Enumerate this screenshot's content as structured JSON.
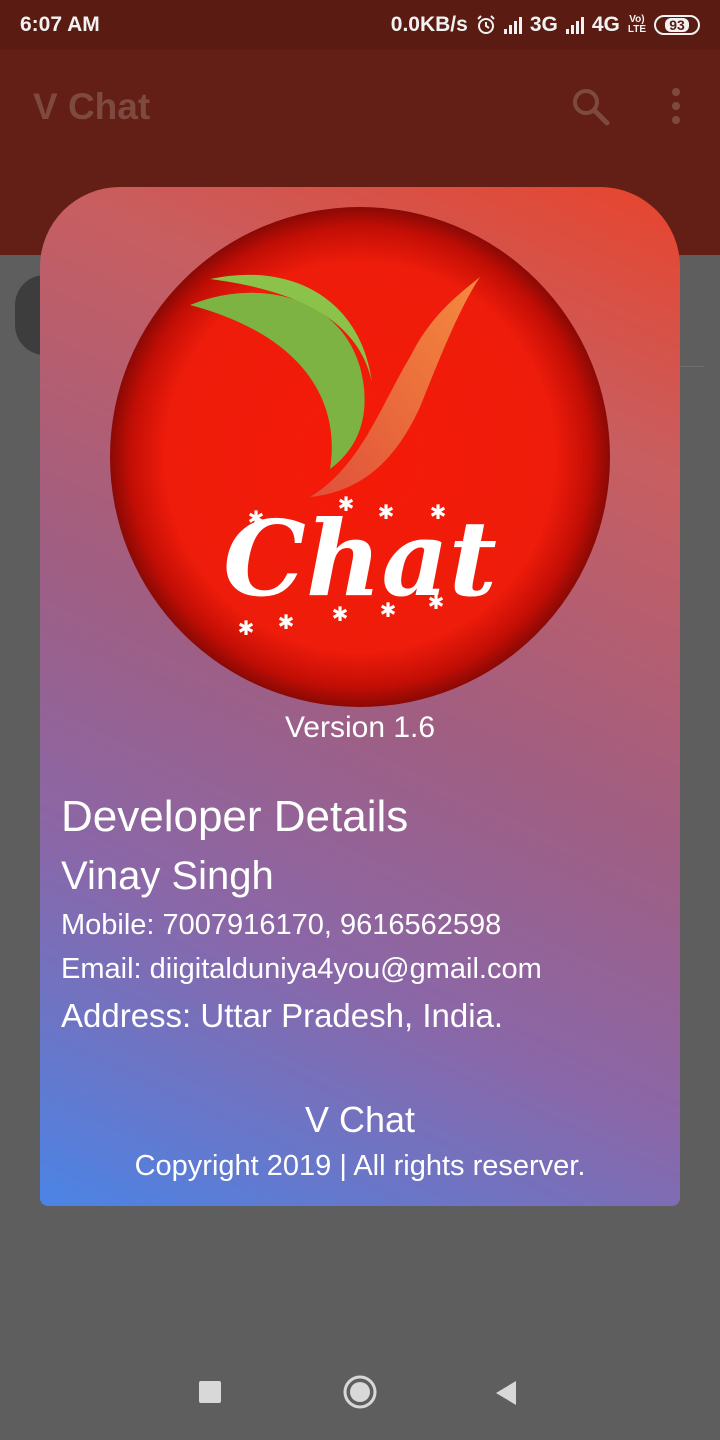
{
  "status_bar": {
    "time": "6:07 AM",
    "speed": "0.0KB/s",
    "net1": "3G",
    "net2": "4G",
    "volte_top": "Vo)",
    "volte_bottom": "LTE",
    "battery": "93"
  },
  "app_bar": {
    "title": "V Chat",
    "icons": [
      "search-icon",
      "more-vert-icon"
    ]
  },
  "dialog": {
    "logo_text": "Chat",
    "version": "Version 1.6",
    "developer_heading": "Developer Details",
    "developer_name": "Vinay Singh",
    "mobile": "Mobile: 7007916170, 9616562598",
    "email": "Email: diigitalduniya4you@gmail.com",
    "address": "Address: Uttar Pradesh, India.",
    "footer_title": "V Chat",
    "copyright": "Copyright 2019 | All rights reserver."
  },
  "colors": {
    "status_bar": "#5a1c12",
    "app_bar": "#631f15",
    "gradient_top": "#e8442c",
    "gradient_bottom": "#4b84e6",
    "logo_red": "#ee1d0c",
    "logo_green": "#7cb342",
    "logo_orange": "#f07a3c"
  }
}
